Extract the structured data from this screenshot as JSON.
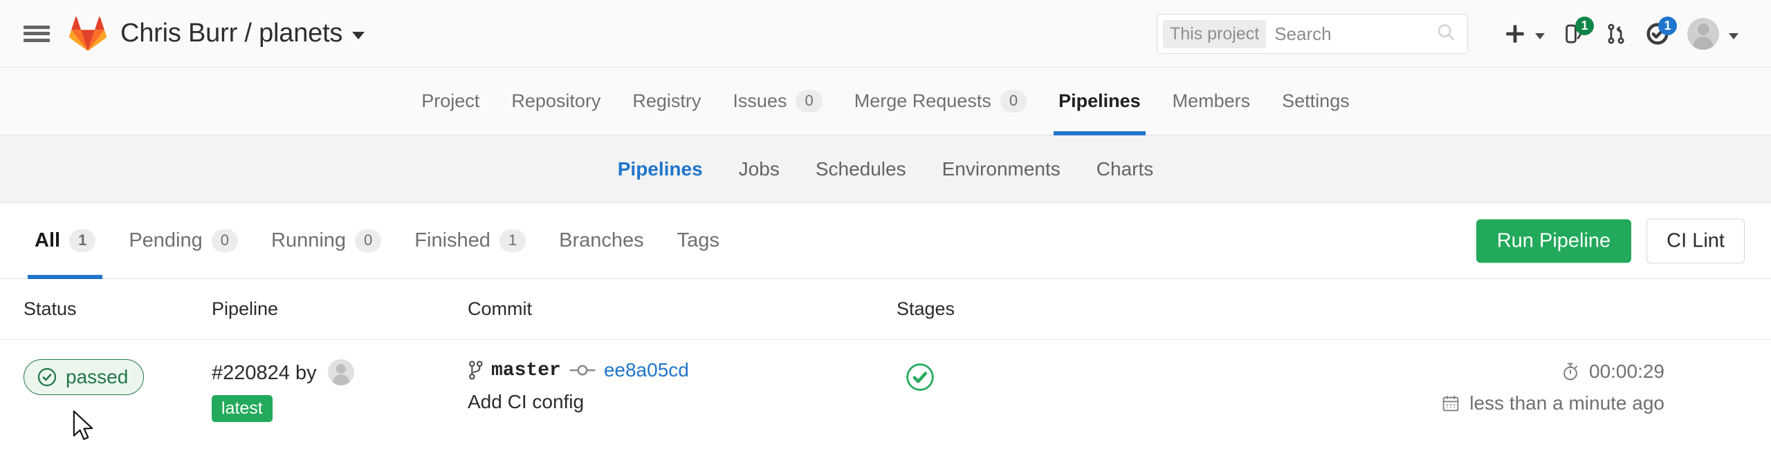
{
  "topbar": {
    "menu_icon": "hamburger-menu-icon",
    "logo_icon": "gitlab-logo-icon",
    "project_title": "Chris Burr / planets",
    "search": {
      "scope_label": "This project",
      "placeholder": "Search",
      "value": "",
      "icon": "search-icon"
    },
    "actions": [
      {
        "name": "new-dropdown",
        "icon": "plus-icon",
        "badge": ""
      },
      {
        "name": "issues-dropdown",
        "icon": "issues-icon",
        "badge": "1",
        "badge_color": "#108548"
      },
      {
        "name": "merge-requests-link",
        "icon": "merge-request-icon",
        "badge": ""
      },
      {
        "name": "todos-link",
        "icon": "todo-check-icon",
        "badge": "1",
        "badge_color": "#1f75cb"
      },
      {
        "name": "user-avatar-dropdown",
        "icon": "avatar-icon",
        "badge": ""
      }
    ]
  },
  "project_nav": [
    {
      "label": "Project",
      "count": "",
      "active": false
    },
    {
      "label": "Repository",
      "count": "",
      "active": false
    },
    {
      "label": "Registry",
      "count": "",
      "active": false
    },
    {
      "label": "Issues",
      "count": "0",
      "active": false
    },
    {
      "label": "Merge Requests",
      "count": "0",
      "active": false
    },
    {
      "label": "Pipelines",
      "count": "",
      "active": true
    },
    {
      "label": "Members",
      "count": "",
      "active": false
    },
    {
      "label": "Settings",
      "count": "",
      "active": false
    }
  ],
  "sub_nav": [
    {
      "label": "Pipelines",
      "active": true
    },
    {
      "label": "Jobs",
      "active": false
    },
    {
      "label": "Schedules",
      "active": false
    },
    {
      "label": "Environments",
      "active": false
    },
    {
      "label": "Charts",
      "active": false
    }
  ],
  "filter_tabs": [
    {
      "label": "All",
      "count": "1",
      "active": true
    },
    {
      "label": "Pending",
      "count": "0",
      "active": false
    },
    {
      "label": "Running",
      "count": "0",
      "active": false
    },
    {
      "label": "Finished",
      "count": "1",
      "active": false
    },
    {
      "label": "Branches",
      "count": "",
      "active": false
    },
    {
      "label": "Tags",
      "count": "",
      "active": false
    }
  ],
  "toolbar": {
    "run_pipeline_label": "Run Pipeline",
    "ci_lint_label": "CI Lint"
  },
  "table": {
    "headers": {
      "status": "Status",
      "pipeline": "Pipeline",
      "commit": "Commit",
      "stages": "Stages"
    },
    "rows": [
      {
        "status": {
          "label": "passed",
          "icon": "status-passed-icon",
          "color": "#217645"
        },
        "pipeline": {
          "id": "#220824",
          "by_label": "by",
          "avatar": "user-avatar-icon",
          "tag": "latest"
        },
        "commit": {
          "branch_icon": "branch-icon",
          "branch": "master",
          "commit_node_icon": "commit-node-icon",
          "sha": "ee8a05cd",
          "message": "Add CI config"
        },
        "stages": {
          "icon": "stage-passed-icon",
          "color": "#22a95b"
        },
        "meta": {
          "duration_icon": "timer-icon",
          "duration": "00:00:29",
          "time_icon": "calendar-icon",
          "time_ago": "less than a minute ago"
        }
      }
    ]
  },
  "colors": {
    "accent_blue": "#1f75cb",
    "success_green": "#22a95b",
    "badge_green_dark": "#217645",
    "topbar_bg": "#fafafa",
    "subnav_bg": "#f3f3f3"
  }
}
